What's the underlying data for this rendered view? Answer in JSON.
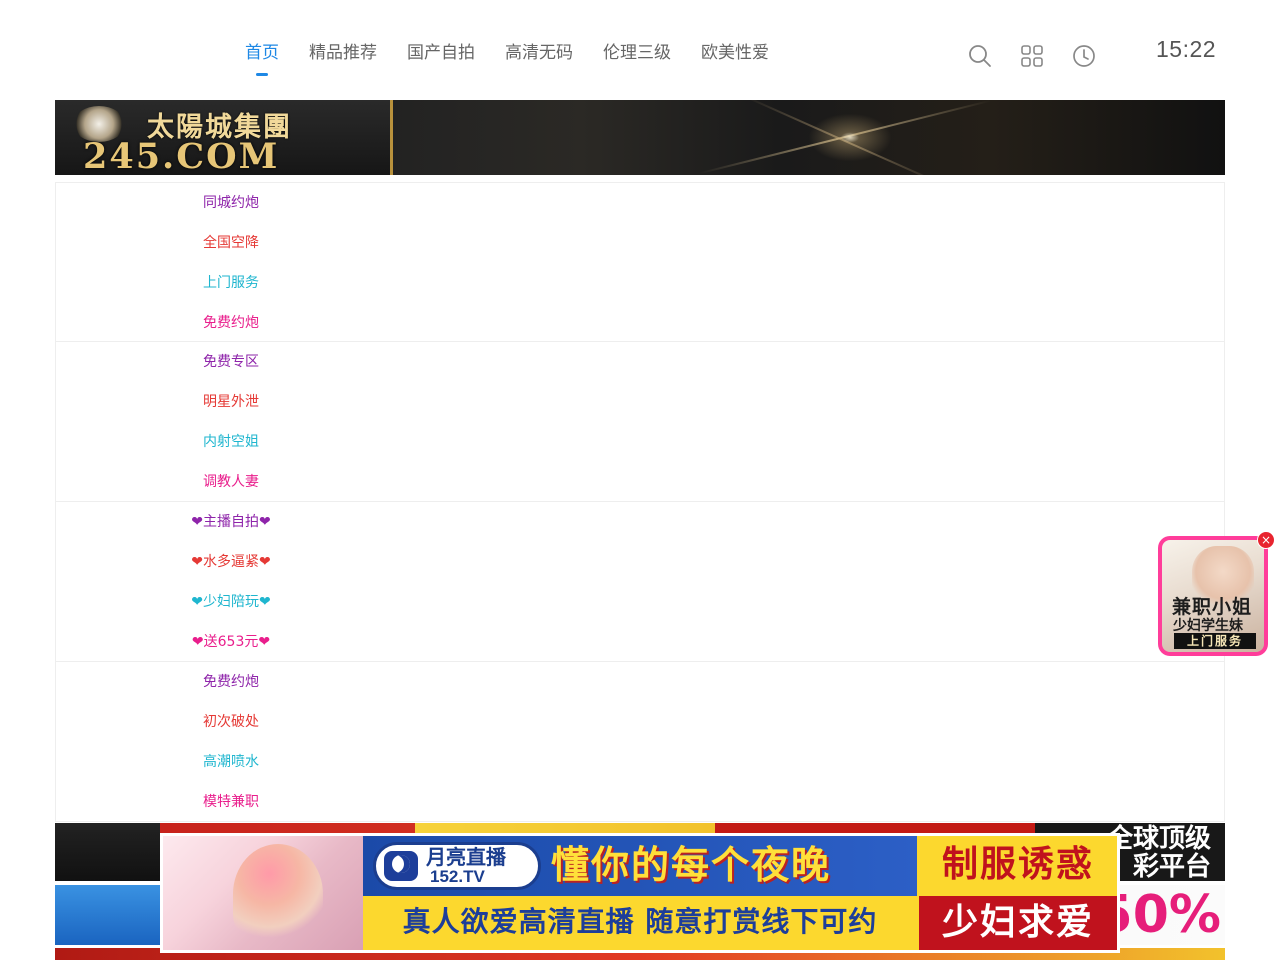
{
  "nav": {
    "items": [
      {
        "label": "首页",
        "active": true
      },
      {
        "label": "精品推荐",
        "active": false
      },
      {
        "label": "国产自拍",
        "active": false
      },
      {
        "label": "高清无码",
        "active": false
      },
      {
        "label": "伦理三级",
        "active": false
      },
      {
        "label": "欧美性爱",
        "active": false
      }
    ],
    "accent_color": "#1e88e5",
    "tool_icons": [
      "search-icon",
      "grid-icon",
      "history-clock-icon"
    ],
    "time": "15:22"
  },
  "top_banner": {
    "brand": "太陽城集團",
    "domain": "245.COM"
  },
  "link_groups": [
    [
      "同城约炮",
      "全国空降",
      "上门服务",
      "免费约炮"
    ],
    [
      "免费专区",
      "明星外泄",
      "内射空姐",
      "调教人妻"
    ],
    [
      "❤主播自拍❤",
      "❤水多逼紧❤",
      "❤少妇陪玩❤",
      "❤送653元❤"
    ],
    [
      "免费约炮",
      "初次破处",
      "高潮喷水",
      "模特兼职"
    ]
  ],
  "link_colors": [
    "#8e24aa",
    "#e53935",
    "#1fb6cf",
    "#e91e8c"
  ],
  "float_ad": {
    "line1": "兼职小姐",
    "line2": "少妇学生妹",
    "line3": "上门服务",
    "close": "×"
  },
  "bottom_banners": {
    "banner1_text_line1": "全球顶级",
    "banner1_text_line2": "彩平台",
    "banner2_percent": "50%"
  },
  "live_ad": {
    "brand": "月亮直播",
    "domain": "152.TV",
    "headline": "懂你的每个夜晚",
    "subline": "真人欲爱高清直播 随意打赏线下可约",
    "right_top": "制服诱惑",
    "right_bottom": "少妇求爱"
  }
}
